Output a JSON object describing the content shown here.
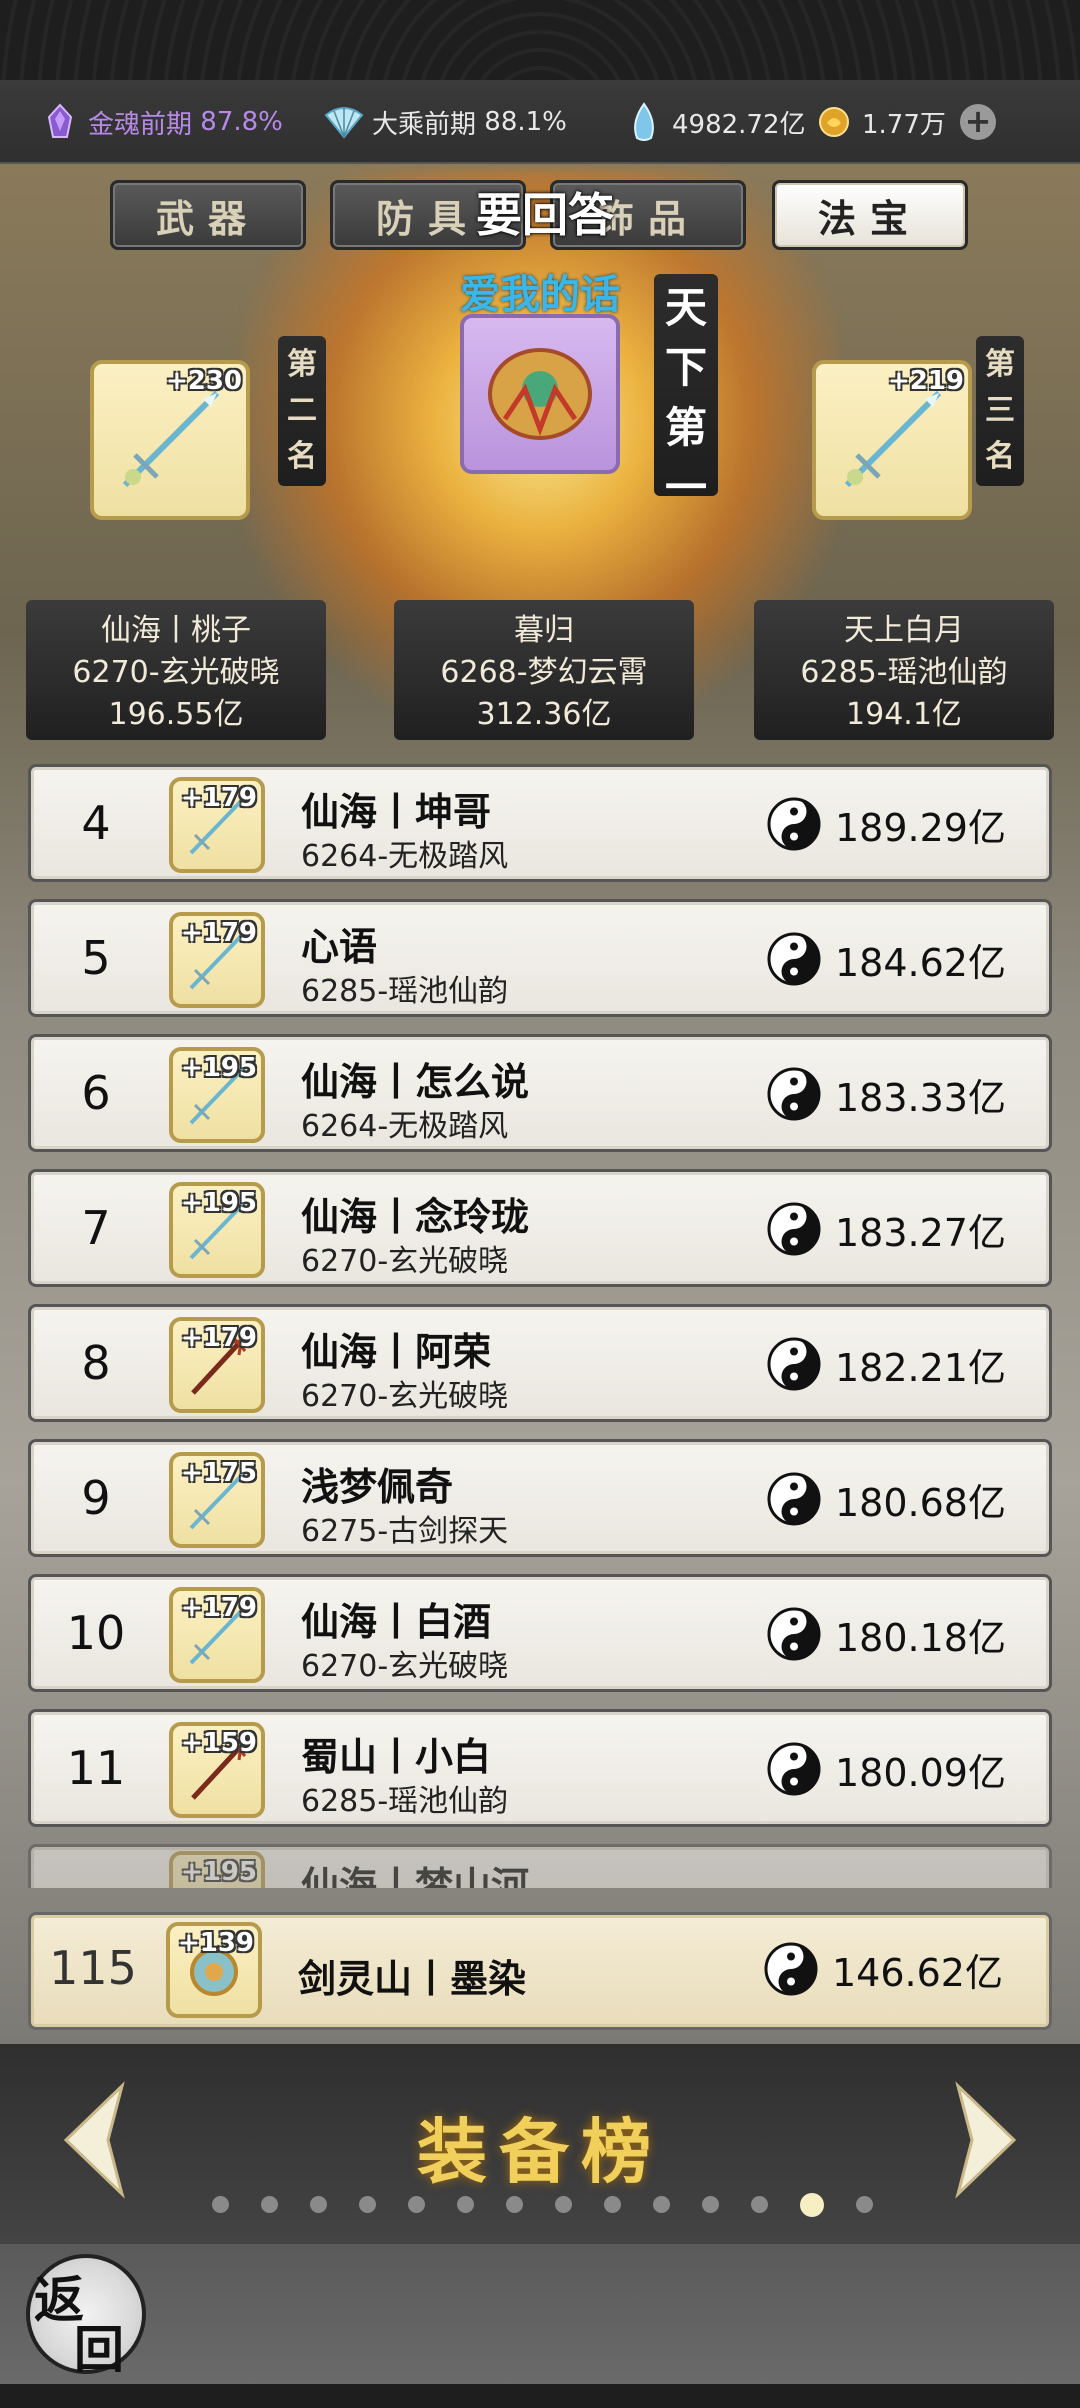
{
  "status": {
    "soul": {
      "icon": "soul-crystal-icon",
      "label": "金魂前期",
      "value": "87.8%"
    },
    "realm": {
      "icon": "fan-icon",
      "label": "大乘前期",
      "value": "88.1%"
    },
    "spirit": {
      "icon": "spirit-stone-icon",
      "value": "4982.72亿"
    },
    "gold": {
      "icon": "gold-ingot-icon",
      "value": "1.77万"
    }
  },
  "tabs": [
    {
      "label": "武器",
      "active": false
    },
    {
      "label": "防具",
      "active": false
    },
    {
      "label": "饰品",
      "active": false
    },
    {
      "label": "法宝",
      "active": true
    }
  ],
  "overlay_text": "要回答",
  "love_text": "爱我的话",
  "top3": {
    "first": {
      "banner": "天下第一",
      "name": "暮归",
      "equip": "6268-梦幻云霄",
      "value": "312.36亿"
    },
    "second": {
      "banner": "第二名",
      "level": "+230",
      "name": "仙海丨桃子",
      "equip": "6270-玄光破晓",
      "value": "196.55亿"
    },
    "third": {
      "banner": "第三名",
      "level": "+219",
      "name": "天上白月",
      "equip": "6285-瑶池仙韵",
      "value": "194.1亿"
    }
  },
  "rows": [
    {
      "rank": "4",
      "level": "+179",
      "name": "仙海丨坤哥",
      "equip": "6264-无极踏风",
      "value": "189.29亿"
    },
    {
      "rank": "5",
      "level": "+179",
      "name": "心语",
      "equip": "6285-瑶池仙韵",
      "value": "184.62亿"
    },
    {
      "rank": "6",
      "level": "+195",
      "name": "仙海丨怎么说",
      "equip": "6264-无极踏风",
      "value": "183.33亿"
    },
    {
      "rank": "7",
      "level": "+195",
      "name": "仙海丨念玲珑",
      "equip": "6270-玄光破晓",
      "value": "183.27亿"
    },
    {
      "rank": "8",
      "level": "+179",
      "name": "仙海丨阿荣",
      "equip": "6270-玄光破晓",
      "value": "182.21亿"
    },
    {
      "rank": "9",
      "level": "+175",
      "name": "浅梦佩奇",
      "equip": "6275-古剑探天",
      "value": "180.68亿"
    },
    {
      "rank": "10",
      "level": "+179",
      "name": "仙海丨白酒",
      "equip": "6270-玄光破晓",
      "value": "180.18亿"
    },
    {
      "rank": "11",
      "level": "+159",
      "name": "蜀山丨小白",
      "equip": "6285-瑶池仙韵",
      "value": "180.09亿"
    }
  ],
  "partial_row": {
    "level": "+195",
    "name": "仙海丨梦山河"
  },
  "my_row": {
    "rank": "115",
    "level": "+139",
    "name": "剑灵山丨墨染",
    "value": "146.62亿"
  },
  "page_title": "装备榜",
  "pager": {
    "count": 14,
    "active_index": 12
  },
  "back_label": {
    "top": "返",
    "bottom": "回"
  }
}
